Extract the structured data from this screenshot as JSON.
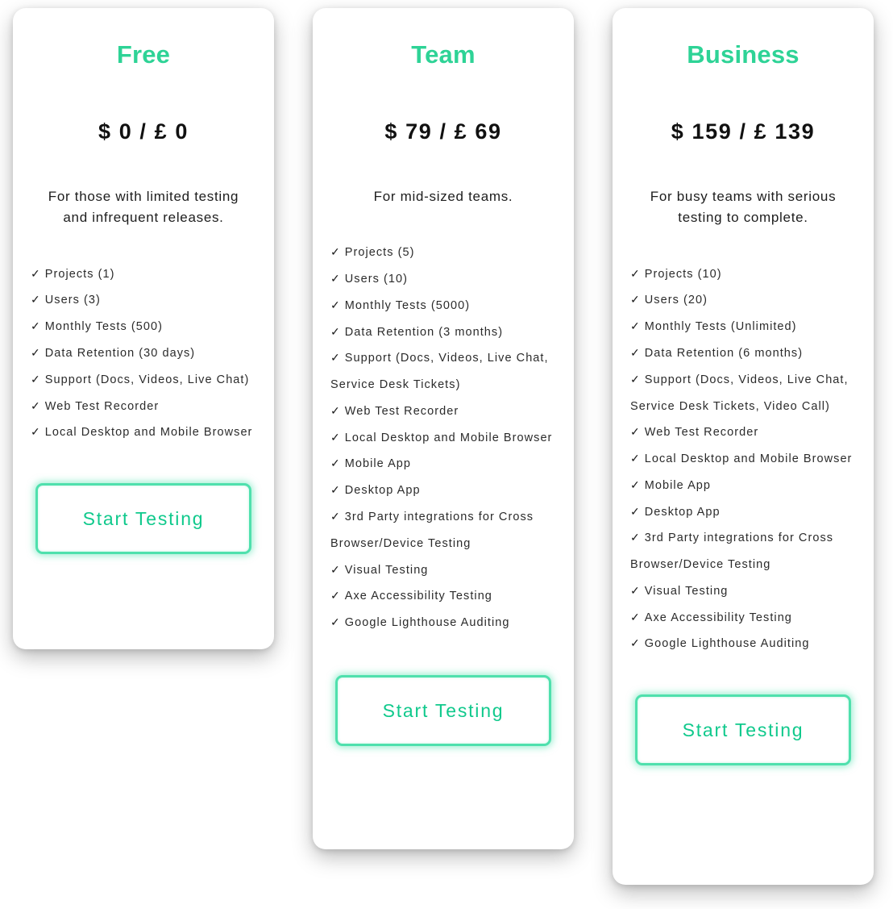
{
  "page": {
    "accent_color": "#2ed396",
    "button_border_color": "#4fe0ad",
    "button_text_color": "#10c98c",
    "card_background": "#ffffff",
    "text_color": "#2b2b2b"
  },
  "check_icon": "✓",
  "plans": [
    {
      "name": "Free",
      "price": "$ 0 / £ 0",
      "tagline": "For those with limited testing and infrequent releases.",
      "features": [
        "Projects (1)",
        "Users (3)",
        "Monthly Tests (500)",
        "Data Retention (30 days)",
        "Support (Docs, Videos, Live Chat)",
        "Web Test Recorder",
        "Local Desktop and Mobile Browser"
      ],
      "cta_label": "Start Testing"
    },
    {
      "name": "Team",
      "price": "$ 79 / £ 69",
      "tagline": "For mid-sized teams.",
      "features": [
        "Projects (5)",
        "Users (10)",
        "Monthly Tests (5000)",
        "Data Retention (3 months)",
        "Support (Docs, Videos, Live Chat, Service Desk Tickets)",
        "Web Test Recorder",
        "Local Desktop and Mobile Browser",
        "Mobile App",
        "Desktop App",
        "3rd Party integrations for Cross Browser/Device Testing",
        "Visual Testing",
        "Axe Accessibility Testing",
        "Google Lighthouse Auditing"
      ],
      "cta_label": "Start Testing"
    },
    {
      "name": "Business",
      "price": "$ 159 / £ 139",
      "tagline": "For busy teams with serious testing to complete.",
      "features": [
        "Projects (10)",
        "Users (20)",
        "Monthly Tests (Unlimited)",
        "Data Retention (6 months)",
        "Support (Docs, Videos, Live Chat, Service Desk Tickets, Video Call)",
        "Web Test Recorder",
        "Local Desktop and Mobile Browser",
        "Mobile App",
        "Desktop App",
        "3rd Party integrations for Cross Browser/Device Testing",
        "Visual Testing",
        "Axe Accessibility Testing",
        "Google Lighthouse Auditing"
      ],
      "cta_label": "Start Testing"
    }
  ]
}
